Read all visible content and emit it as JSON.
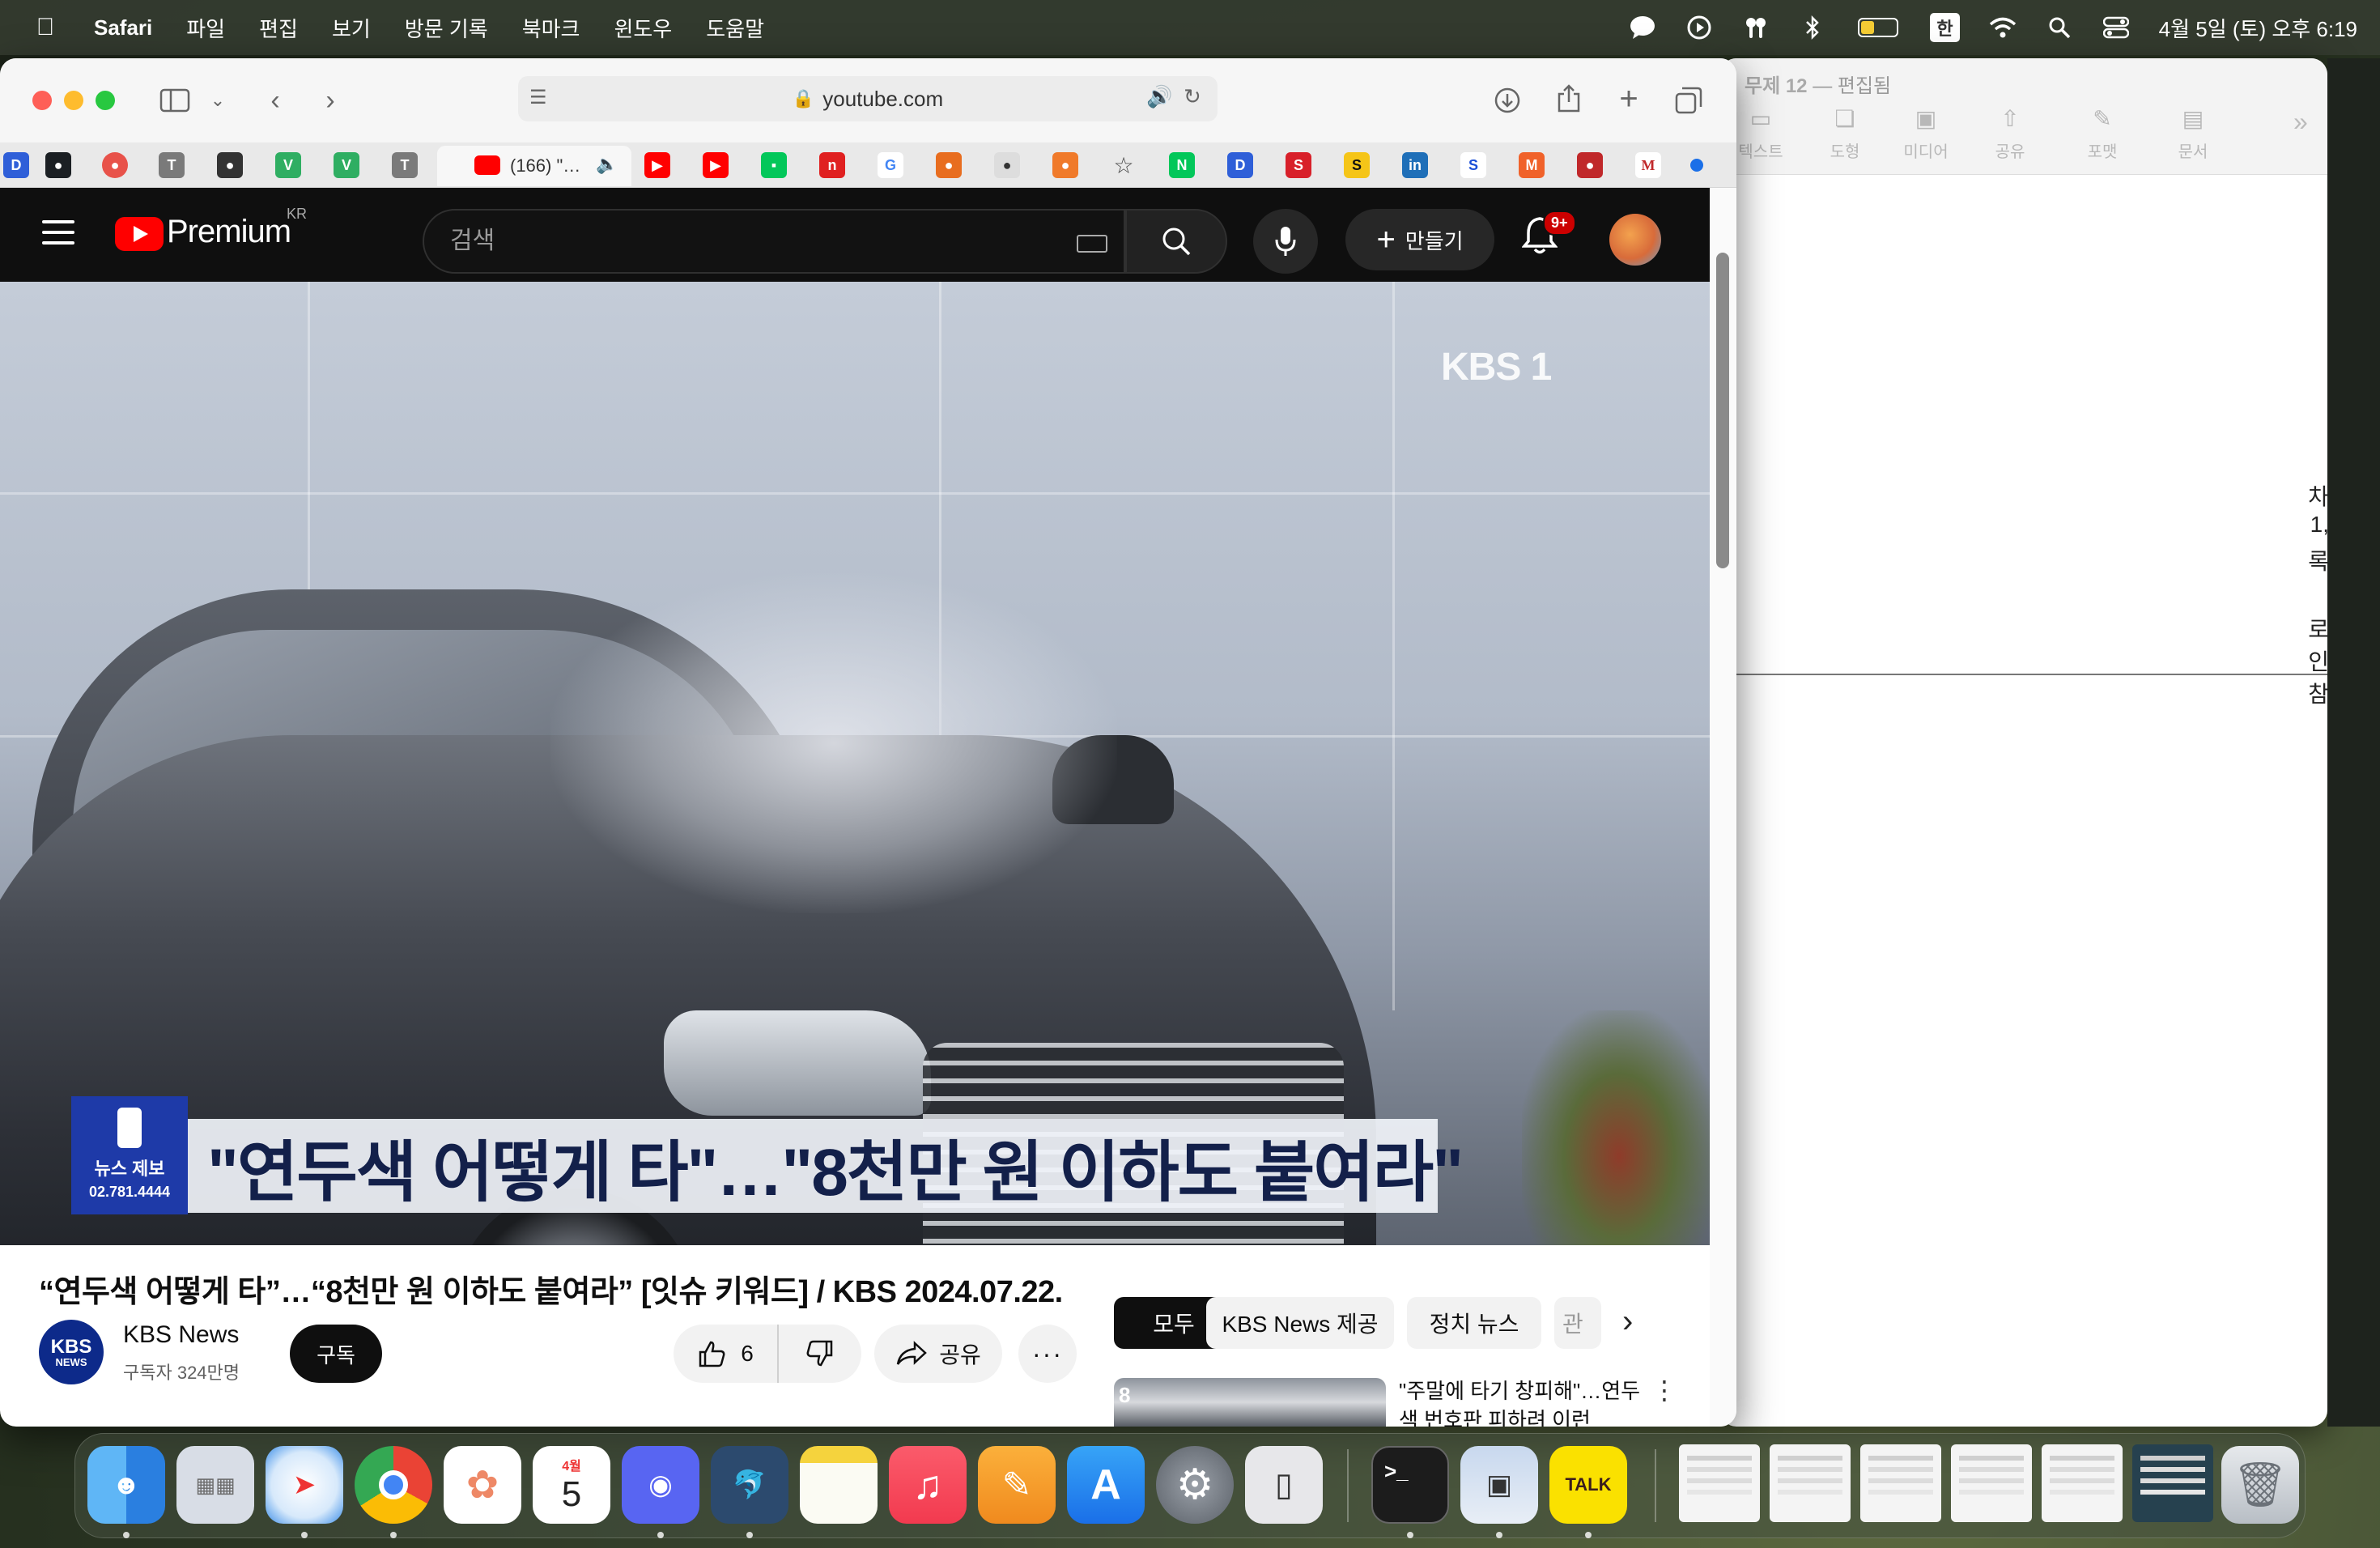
{
  "menubar": {
    "app_name": "Safari",
    "items": [
      "파일",
      "편집",
      "보기",
      "방문 기록",
      "북마크",
      "윈도우",
      "도움말"
    ],
    "ime": "한",
    "clock": "4월 5일 (토) 오후 6:19"
  },
  "background_window": {
    "title": "무제 12",
    "status": "— 편집됨",
    "tools": [
      "텍스트",
      "도형",
      "미디어",
      "공유",
      "포맷",
      "문서"
    ],
    "edge_chars": [
      "차",
      "1,",
      "록",
      "로",
      "인",
      "참"
    ]
  },
  "safari": {
    "url": "youtube.com",
    "active_tab_title": "(166) \"…",
    "favorites": [
      "D",
      "●",
      "●",
      "T",
      "●",
      "V",
      "V",
      "T",
      "▶",
      "▶",
      "▪",
      "n",
      "G",
      "●",
      "●",
      "●",
      "☆",
      "N",
      "D",
      "S",
      "S",
      "in",
      "S",
      "M",
      "●",
      "M"
    ]
  },
  "youtube": {
    "logo_text": "Premium",
    "region": "KR",
    "search_placeholder": "검색",
    "create_label": "만들기",
    "notification_badge": "9+",
    "video": {
      "watermark": "KBS 1",
      "news_box_line1": "뉴스 제보",
      "news_box_line2": "02.781.4444",
      "caption": "\"연두색 어떻게 타\"…\"8천만 원 이하도 붙여라\""
    },
    "title": "“연두색 어떻게 타”…“8천만 원 이하도 붙여라” [잇슈 키워드] / KBS  2024.07.22.",
    "channel": {
      "avatar_text": "KBS",
      "avatar_sub": "NEWS",
      "name": "KBS News",
      "subscribers": "구독자 324만명",
      "subscribe_label": "구독"
    },
    "actions": {
      "likes": "6",
      "share_label": "공유",
      "more": "···"
    },
    "chips": [
      "모두",
      "KBS News 제공",
      "정치 뉴스",
      "관"
    ],
    "recommendation": {
      "thumb_label": "8",
      "title": "\"주말에 타기 창피해\"…연두색 번호판 피하려 이런"
    }
  },
  "colors": {
    "yt_red": "#ff0000",
    "yt_dark": "#0f0f0f",
    "kbs_blue": "#1e3aa8"
  }
}
